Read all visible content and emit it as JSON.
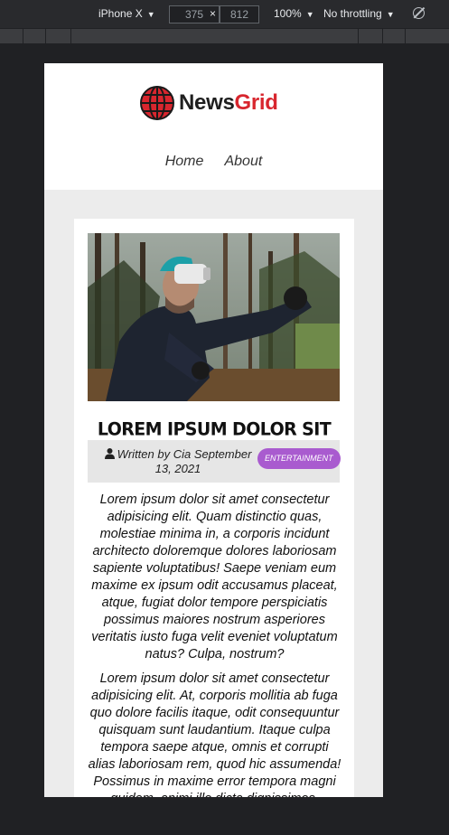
{
  "devtools": {
    "device": "iPhone X",
    "width": "375",
    "height": "812",
    "times": "×",
    "zoom": "100%",
    "throttling": "No throttling"
  },
  "site": {
    "logo_prefix": "News",
    "logo_suffix": "Grid",
    "nav": [
      "Home",
      "About"
    ]
  },
  "post": {
    "title": "LOREM IPSUM DOLOR SIT AMET.",
    "author_line": "Written by Cia September 13, 2021",
    "category": "ENTERTAINMENT",
    "paragraphs": [
      "Lorem ipsum dolor sit amet consectetur adipisicing elit. Quam distinctio quas, molestiae minima in, a corporis incidunt architecto doloremque dolores laboriosam sapiente voluptatibus! Saepe veniam eum maxime ex ipsum odit accusamus placeat, atque, fugiat dolor tempore perspiciatis possimus maiores nostrum asperiores veritatis iusto fuga velit eveniet voluptatum natus? Culpa, nostrum?",
      "Lorem ipsum dolor sit amet consectetur adipisicing elit. At, corporis mollitia ab fuga quo dolore facilis itaque, odit consequuntur quisquam sunt laudantium. Itaque culpa tempora saepe atque, omnis et corrupti alias laboriosam rem, quod hic assumenda! Possimus in maxime error tempora magni quidem, animi illo dicta dignissimos."
    ]
  },
  "colors": {
    "brand_red": "#d8262e",
    "badge": "#a95bcf",
    "page_bg": "#ececec"
  }
}
